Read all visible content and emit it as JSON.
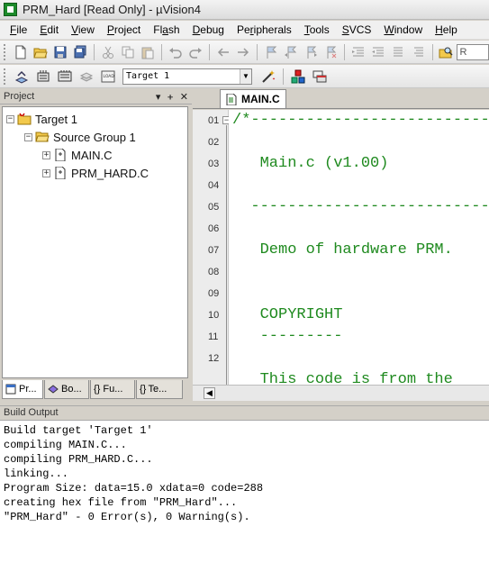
{
  "window": {
    "title": "PRM_Hard [Read Only]  - µVision4"
  },
  "menu": [
    {
      "pre": "",
      "ul": "F",
      "post": "ile"
    },
    {
      "pre": "",
      "ul": "E",
      "post": "dit"
    },
    {
      "pre": "",
      "ul": "V",
      "post": "iew"
    },
    {
      "pre": "",
      "ul": "P",
      "post": "roject"
    },
    {
      "pre": "Fl",
      "ul": "a",
      "post": "sh"
    },
    {
      "pre": "",
      "ul": "D",
      "post": "ebug"
    },
    {
      "pre": "Pe",
      "ul": "r",
      "post": "ipherals"
    },
    {
      "pre": "",
      "ul": "T",
      "post": "ools"
    },
    {
      "pre": "",
      "ul": "S",
      "post": "VCS"
    },
    {
      "pre": "",
      "ul": "W",
      "post": "indow"
    },
    {
      "pre": "",
      "ul": "H",
      "post": "elp"
    }
  ],
  "toolbar": {
    "find_text": "R"
  },
  "build_toolbar": {
    "target": "Target 1"
  },
  "project_panel": {
    "title": "Project",
    "tree": {
      "root": "Target 1",
      "group": "Source Group 1",
      "files": [
        "MAIN.C",
        "PRM_HARD.C"
      ]
    },
    "tabs": [
      "Pr...",
      "Bo...",
      "{} Fu...",
      "{} Te..."
    ]
  },
  "editor": {
    "active_tab": "MAIN.C",
    "line_numbers": [
      "01",
      "02",
      "03",
      "04",
      "05",
      "06",
      "07",
      "08",
      "09",
      "10",
      "11",
      "12"
    ],
    "code_lines": [
      "/*---------------------------------------",
      "",
      "   Main.c (v1.00)",
      "",
      "  ---------------------------------------",
      "",
      "   Demo of hardware PRM.",
      "",
      "",
      "   COPYRIGHT",
      "   ---------",
      "",
      "   This code is from the"
    ]
  },
  "build_output": {
    "title": "Build Output",
    "lines": [
      "Build target 'Target 1'",
      "compiling MAIN.C...",
      "compiling PRM_HARD.C...",
      "linking...",
      "Program Size: data=15.0 xdata=0 code=288",
      "creating hex file from \"PRM_Hard\"...",
      "\"PRM_Hard\" - 0 Error(s), 0 Warning(s)."
    ]
  }
}
